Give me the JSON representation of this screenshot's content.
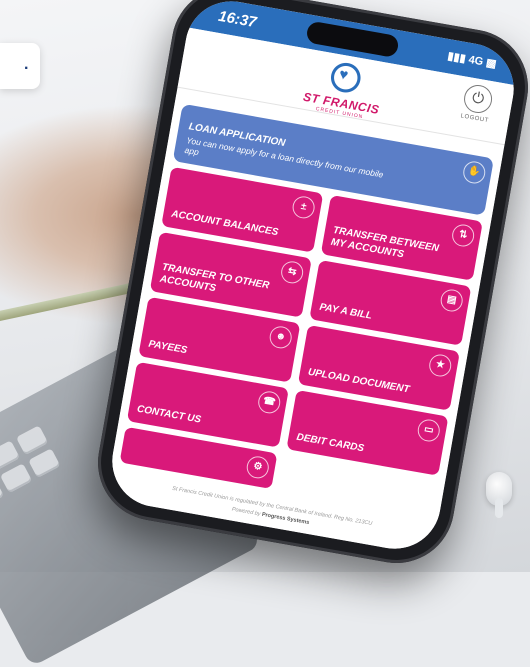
{
  "colors": {
    "primary_blue": "#2a6ebb",
    "loan_tile": "#5b7ec7",
    "tile_pink": "#d9197a",
    "brand_pink": "#d1196a"
  },
  "corner_card": {
    "text": "."
  },
  "status_bar": {
    "time": "16:37",
    "network": "4G"
  },
  "header": {
    "logo_name": "ST FRANCIS",
    "logo_subtitle": "CREDIT UNION",
    "logout_label": "LOGOUT",
    "logout_icon": "power-icon"
  },
  "loan": {
    "title": "LOAN APPLICATION",
    "description": "You can now apply for a loan directly from our mobile app",
    "icon": "hand-money-icon"
  },
  "tiles": [
    {
      "label": "ACCOUNT BALANCES",
      "icon": "plus-minus-icon"
    },
    {
      "label": "TRANSFER BETWEEN MY ACCOUNTS",
      "icon": "transfer-icon"
    },
    {
      "label": "TRANSFER TO OTHER ACCOUNTS",
      "icon": "swap-icon"
    },
    {
      "label": "PAY A BILL",
      "icon": "receipt-icon"
    },
    {
      "label": "PAYEES",
      "icon": "payees-icon"
    },
    {
      "label": "UPLOAD DOCUMENT",
      "icon": "star-icon"
    },
    {
      "label": "CONTACT US",
      "icon": "phone-icon"
    },
    {
      "label": "DEBIT CARDS",
      "icon": "card-icon"
    },
    {
      "label": "",
      "icon": "gear-icon"
    }
  ],
  "footer": {
    "regulation": "St Francis Credit Union is regulated by the Central Bank of Ireland. Reg No. 213CU",
    "powered_by_prefix": "Powered by",
    "powered_by": "Progress Systems"
  }
}
